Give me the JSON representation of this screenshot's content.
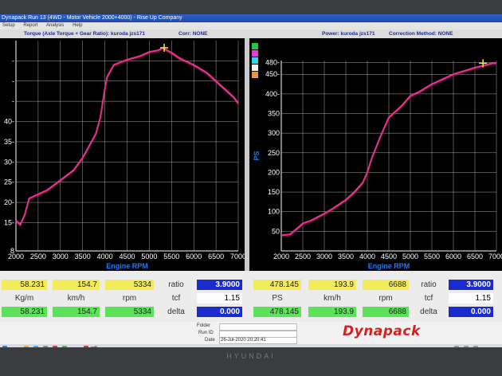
{
  "window": {
    "title": "Dynapack Run 13 (4WD - Motor Vehicle 2000+4000) - Rise Up Company",
    "menu": [
      "Setup",
      "Report",
      "Analysis",
      "Help"
    ]
  },
  "info": {
    "left_caption": "Torque (Axle Torque + Gear Ratio): kuroda jzs171",
    "left_corr": "Corr: NONE",
    "right_caption": "Power: kuroda jzs171",
    "right_corr": "Correction Method: NONE"
  },
  "colors": {
    "curve": "#e6338c",
    "grid": "#cfcfcf",
    "axis_text": "#ffffff",
    "axis_title": "#1a7cff",
    "marker": "#f2e64a"
  },
  "swatches": [
    "#2ac443",
    "#e83ad6",
    "#2bd9e6",
    "#f3f3f3",
    "#f0923a"
  ],
  "chart_data": [
    {
      "type": "line",
      "xlabel": "Engine RPM",
      "ylabel": "",
      "x_ticks": [
        "2000",
        "2500",
        "3000",
        "3500",
        "4000",
        "4500",
        "5000",
        "5500",
        "6000",
        "6500",
        "7000"
      ],
      "y_ticks": [
        {
          "v": 8,
          "label": "8"
        },
        {
          "v": 15,
          "label": "15-"
        },
        {
          "v": 20,
          "label": "20-"
        },
        {
          "v": 25,
          "label": "25-"
        },
        {
          "v": 30,
          "label": "30-"
        },
        {
          "v": 35,
          "label": "35-"
        },
        {
          "v": 40,
          "label": "40-"
        },
        {
          "v": 45,
          "label": "-"
        },
        {
          "v": 50,
          "label": "-"
        },
        {
          "v": 55,
          "label": "-"
        }
      ],
      "xlim": [
        2000,
        7000
      ],
      "ylim": [
        8,
        60
      ],
      "grid": true,
      "series": [
        {
          "x": [
            2000,
            2100,
            2200,
            2300,
            2500,
            2700,
            3000,
            3300,
            3500,
            3600,
            3800,
            3900,
            4000,
            4050,
            4200,
            4500,
            4800,
            5000,
            5200,
            5300,
            5500,
            5700,
            6000,
            6300,
            6500,
            6700,
            6900,
            7000
          ],
          "y": [
            15.5,
            14.5,
            17,
            21,
            22,
            23,
            25.5,
            28,
            31,
            33,
            37,
            41,
            48,
            51,
            54,
            55.3,
            56.2,
            57.2,
            57.6,
            58.2,
            57,
            55.5,
            54,
            52,
            50,
            48,
            46,
            44.5
          ]
        }
      ],
      "marker": {
        "x": 5334,
        "y": 58.231
      }
    },
    {
      "type": "line",
      "xlabel": "Engine RPM",
      "ylabel": "PS",
      "x_ticks": [
        "2000",
        "2500",
        "3000",
        "3500",
        "4000",
        "4500",
        "5000",
        "5500",
        "6000",
        "6500",
        "7000"
      ],
      "y_ticks": [
        {
          "v": 50,
          "label": "50"
        },
        {
          "v": 100,
          "label": "100"
        },
        {
          "v": 150,
          "label": "150"
        },
        {
          "v": 200,
          "label": "200"
        },
        {
          "v": 250,
          "label": "250"
        },
        {
          "v": 300,
          "label": "300"
        },
        {
          "v": 350,
          "label": "350"
        },
        {
          "v": 400,
          "label": "400-"
        },
        {
          "v": 450,
          "label": "450-"
        },
        {
          "v": 480,
          "label": "480-"
        }
      ],
      "xlim": [
        2000,
        7000
      ],
      "ylim": [
        0,
        485
      ],
      "grid": true,
      "series": [
        {
          "x": [
            2000,
            2200,
            2400,
            2500,
            2700,
            3000,
            3200,
            3500,
            3700,
            3900,
            4000,
            4100,
            4300,
            4500,
            4800,
            5000,
            5200,
            5500,
            5800,
            6000,
            6300,
            6500,
            6700,
            6900,
            7000
          ],
          "y": [
            40,
            42,
            60,
            70,
            78,
            95,
            108,
            130,
            150,
            175,
            200,
            235,
            290,
            340,
            370,
            395,
            405,
            425,
            440,
            450,
            460,
            467,
            472,
            478,
            478
          ]
        }
      ],
      "marker": {
        "x": 6688,
        "y": 478.145
      }
    }
  ],
  "readouts": {
    "left": {
      "top": [
        "58.231",
        "154.7",
        "5334"
      ],
      "units": [
        "Kg/m",
        "km/h",
        "rpm"
      ],
      "bottom": [
        "58.231",
        "154.7",
        "5334"
      ]
    },
    "right": {
      "top": [
        "478.145",
        "193.9",
        "6688"
      ],
      "units": [
        "PS",
        "km/h",
        "rpm"
      ],
      "bottom": [
        "478.145",
        "193.9",
        "6688"
      ]
    },
    "side_labels": [
      "ratio",
      "tcf",
      "delta"
    ],
    "left_side_values": [
      "3.9000",
      "1.15",
      "0.000"
    ],
    "right_side_values": [
      "3.9000",
      "1.15",
      "0.000"
    ]
  },
  "footer": {
    "folder_label": "Folder",
    "runid_label": "Run ID",
    "date_label": "Date",
    "date_value": "26-Jul-2020 20:20:41",
    "logo": "Dynapack"
  },
  "taskbar": {
    "item": "pdf"
  },
  "monitor_brand": "HYUNDAI"
}
